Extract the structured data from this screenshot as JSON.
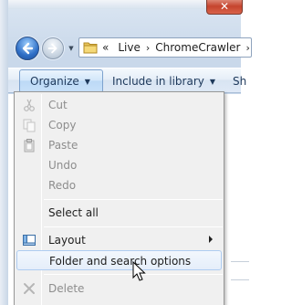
{
  "window": {
    "close_label": "✕"
  },
  "address_bar": {
    "overflow_chevron": "«",
    "crumbs": [
      "Live",
      "ChromeCrawler"
    ],
    "separator": "›"
  },
  "command_bar": {
    "organize_label": "Organize",
    "include_label": "Include in library",
    "share_partial": "Sh",
    "dropdown_arrow": "▼"
  },
  "context_menu": {
    "items": [
      {
        "label": "Cut",
        "enabled": false,
        "icon": "scissors-icon"
      },
      {
        "label": "Copy",
        "enabled": false,
        "icon": "copy-icon"
      },
      {
        "label": "Paste",
        "enabled": false,
        "icon": "paste-icon"
      },
      {
        "label": "Undo",
        "enabled": false,
        "icon": ""
      },
      {
        "label": "Redo",
        "enabled": false,
        "icon": ""
      },
      {
        "label": "Select all",
        "enabled": true,
        "icon": ""
      },
      {
        "label": "Layout",
        "enabled": true,
        "icon": "layout-icon",
        "submenu": true
      },
      {
        "label": "Folder and search options",
        "enabled": true,
        "icon": "",
        "highlighted": true
      },
      {
        "label": "Delete",
        "enabled": false,
        "icon": "delete-x-icon"
      }
    ]
  },
  "colors": {
    "menu_background": "#f0f0f0",
    "highlight_border": "#aeccf1",
    "disabled_text": "#8d8d8d",
    "command_text": "#1e395b"
  }
}
